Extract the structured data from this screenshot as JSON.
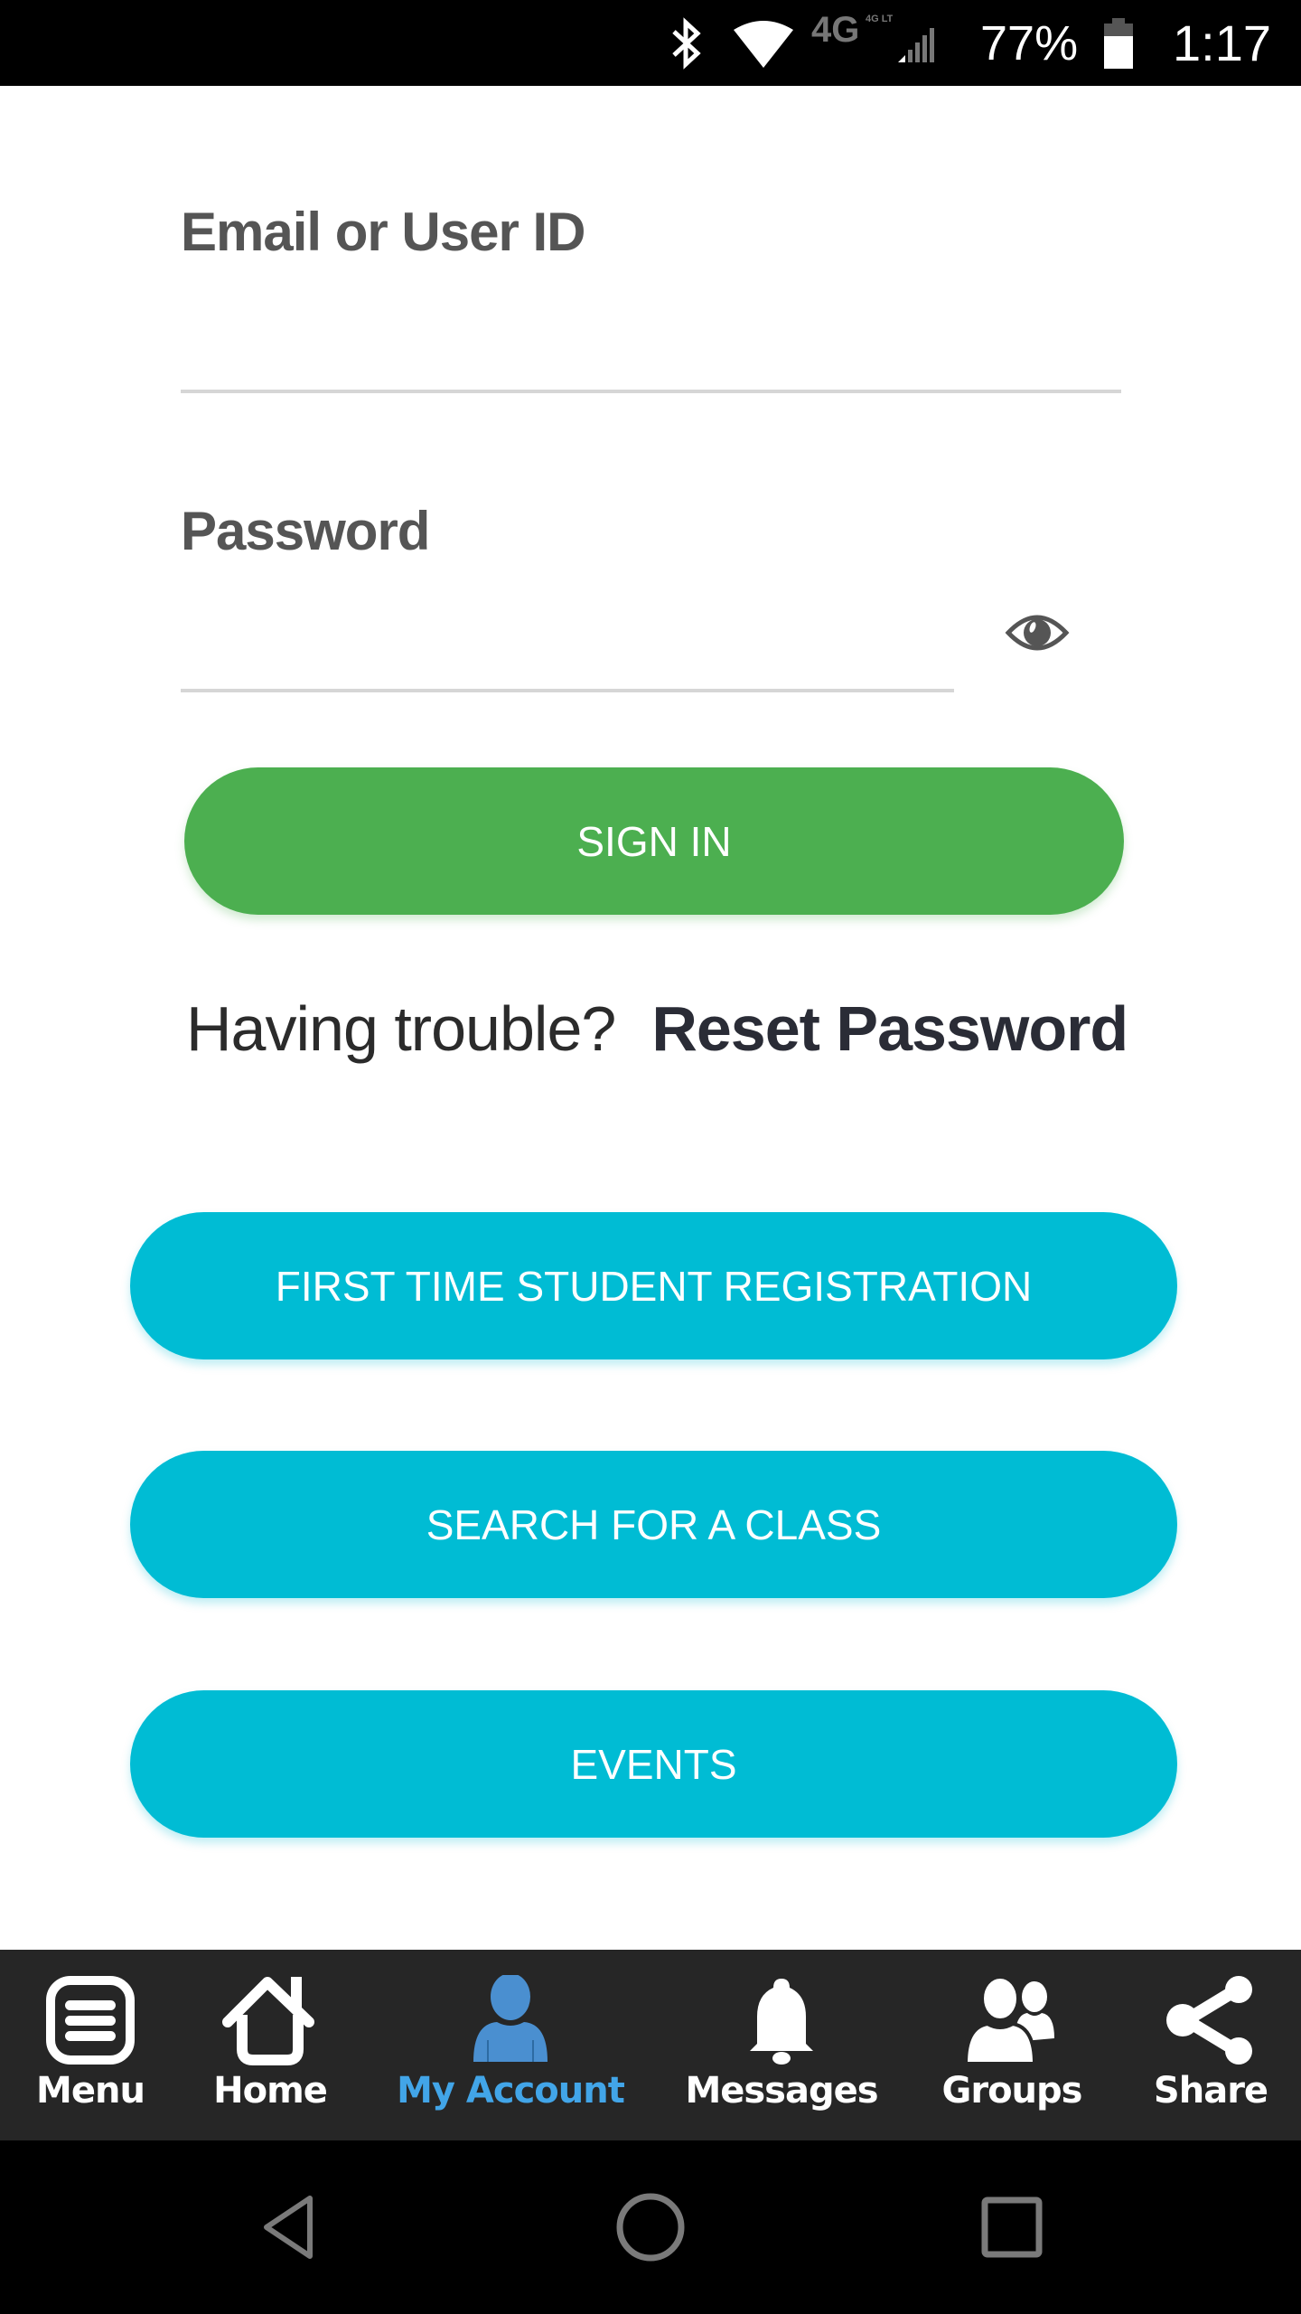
{
  "status_bar": {
    "icons": [
      "bluetooth-icon",
      "wifi-icon",
      "4g-lte-icon",
      "cell-signal-icon",
      "battery-icon"
    ],
    "network_label": "4G LTE",
    "battery_percent": "77%",
    "time": "1:17"
  },
  "login_form": {
    "email": {
      "label": "Email or User ID",
      "value": "",
      "placeholder": ""
    },
    "password": {
      "label": "Password",
      "value": "",
      "placeholder": "",
      "toggle_icon": "eye-icon"
    },
    "sign_in_label": "SIGN IN",
    "trouble_text": "Having trouble?",
    "reset_link": "Reset Password"
  },
  "actions": [
    {
      "label": "FIRST TIME STUDENT REGISTRATION"
    },
    {
      "label": "SEARCH FOR A CLASS"
    },
    {
      "label": "EVENTS"
    }
  ],
  "bottom_nav": {
    "active": "My Account",
    "items": [
      {
        "label": "Menu",
        "icon": "menu-icon"
      },
      {
        "label": "Home",
        "icon": "home-icon"
      },
      {
        "label": "My Account",
        "icon": "person-icon"
      },
      {
        "label": "Messages",
        "icon": "bell-icon"
      },
      {
        "label": "Groups",
        "icon": "group-icon"
      },
      {
        "label": "Share",
        "icon": "share-icon"
      }
    ]
  },
  "system_nav": {
    "items": [
      "back-icon",
      "home-circle-icon",
      "recents-icon"
    ]
  },
  "colors": {
    "sign_in_green": "#4caf50",
    "action_cyan": "#00bcd4",
    "active_nav_blue": "#42a5e8",
    "label_gray": "#555555",
    "nav_bg": "#262626"
  }
}
